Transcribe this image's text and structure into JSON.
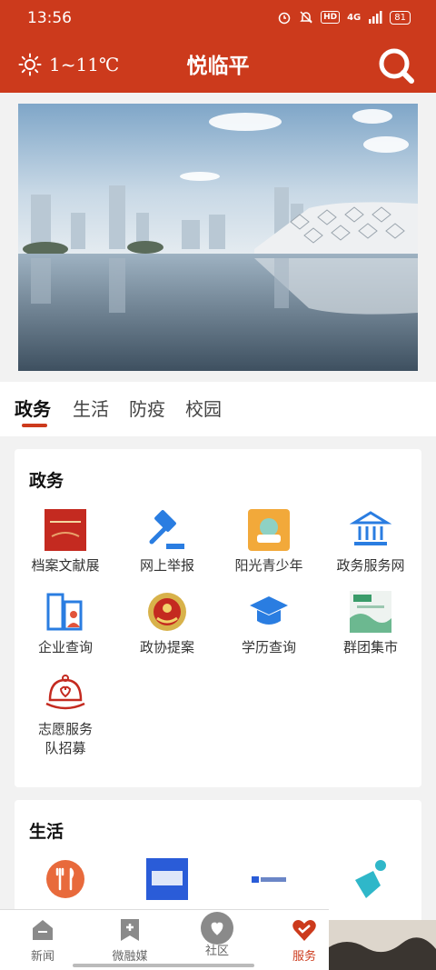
{
  "status": {
    "time": "13:56",
    "hd": "HD",
    "signal": "4G",
    "battery": "81"
  },
  "header": {
    "temp": "1~11℃",
    "title": "悦临平"
  },
  "tabs": [
    "政务",
    "生活",
    "防疫",
    "校园"
  ],
  "sections": {
    "gov": {
      "title": "政务",
      "items": [
        {
          "label": "档案文献展",
          "icon": "archive-exhibit-icon"
        },
        {
          "label": "网上举报",
          "icon": "gavel-icon"
        },
        {
          "label": "阳光青少年",
          "icon": "youth-icon"
        },
        {
          "label": "政务服务网",
          "icon": "government-building-icon"
        },
        {
          "label": "企业查询",
          "icon": "enterprise-icon"
        },
        {
          "label": "政协提案",
          "icon": "emblem-icon"
        },
        {
          "label": "学历查询",
          "icon": "graduation-cap-icon"
        },
        {
          "label": "群团集市",
          "icon": "market-icon"
        },
        {
          "label": "志愿服务队招募",
          "line1": "志愿服务",
          "line2": "队招募",
          "icon": "volunteer-cap-icon"
        }
      ]
    },
    "life": {
      "title": "生活",
      "items": [
        {
          "icon": "restaurant-icon"
        },
        {
          "icon": "food-text-icon"
        },
        {
          "icon": "environment-icon"
        },
        {
          "icon": "sport-runner-icon"
        }
      ]
    }
  },
  "bottom_nav": [
    {
      "label": "新闻",
      "icon": "news-icon"
    },
    {
      "label": "微融媒",
      "icon": "media-bookmark-icon"
    },
    {
      "label": "社区",
      "icon": "community-chat-icon"
    },
    {
      "label": "服务",
      "icon": "service-heart-icon"
    }
  ],
  "colors": {
    "brand": "#cc3a1c",
    "blue": "#2a7de1"
  }
}
